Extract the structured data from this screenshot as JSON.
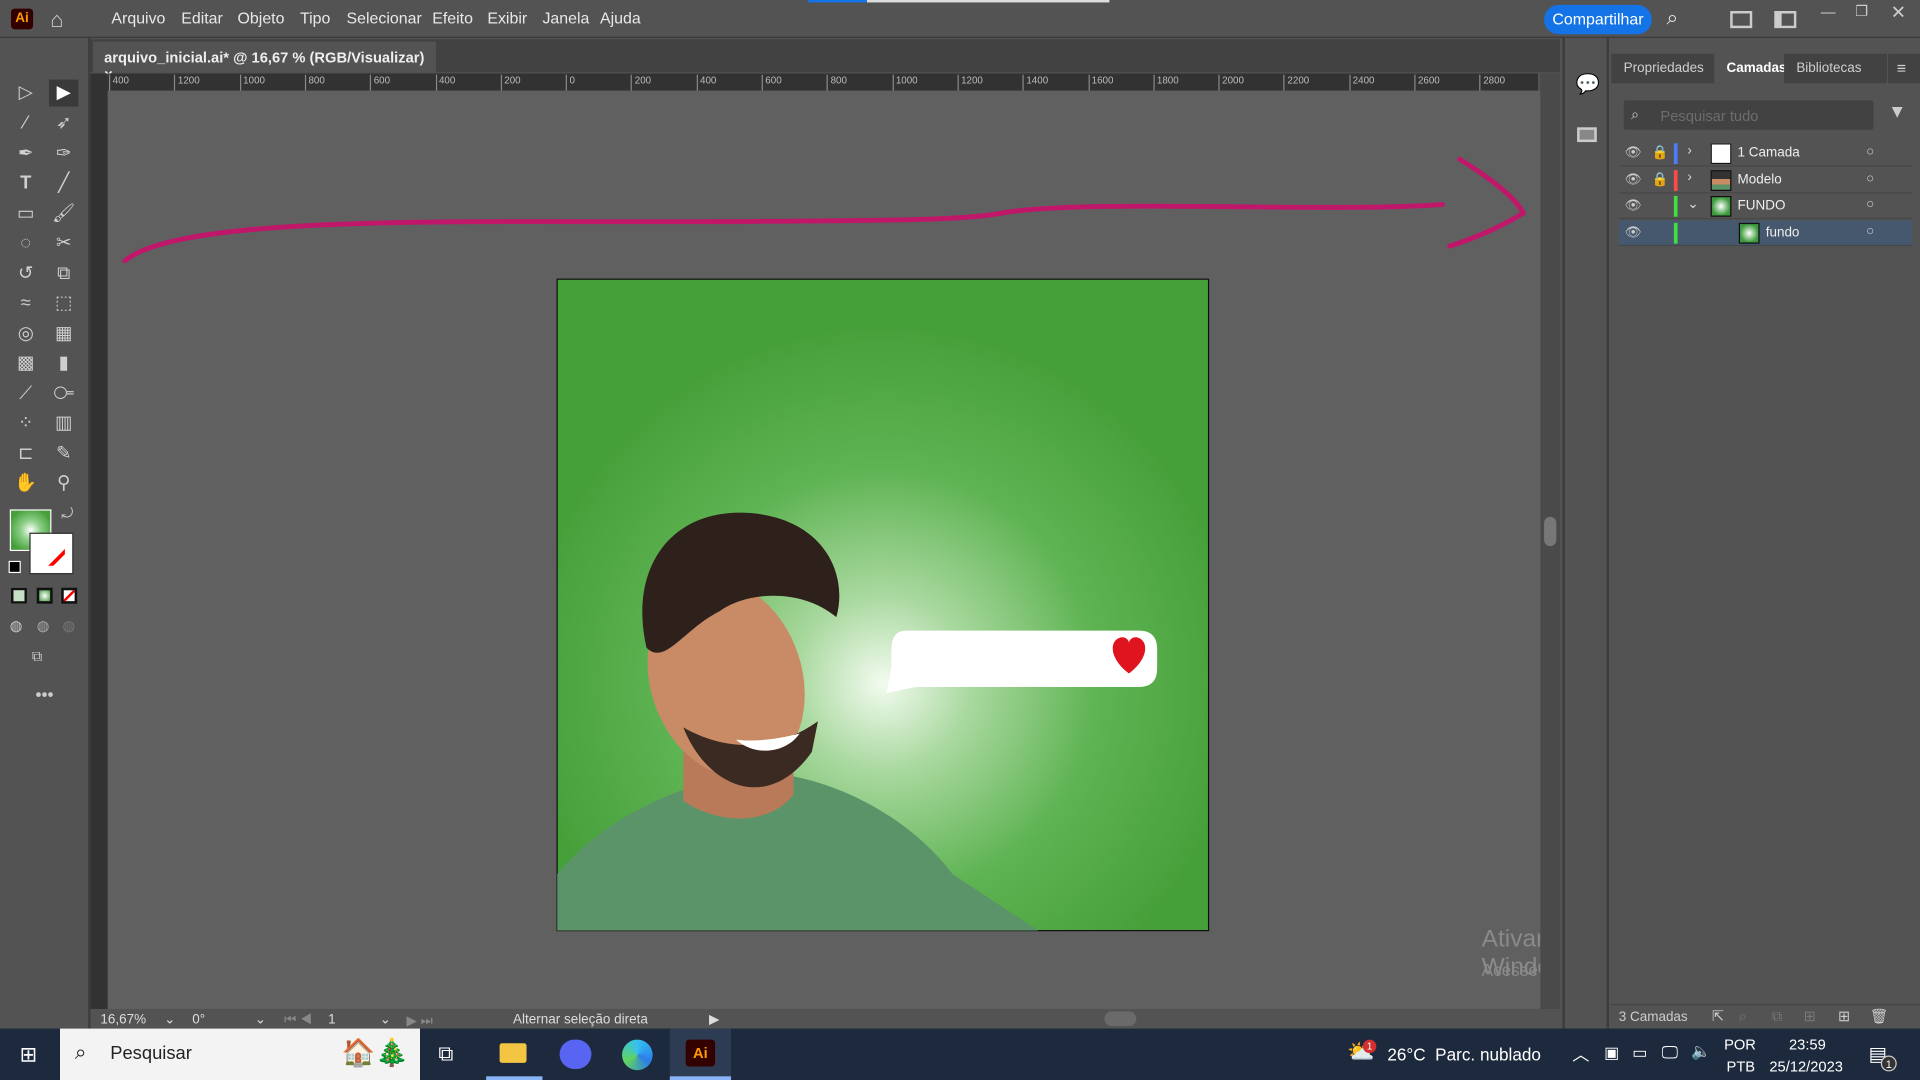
{
  "app": {
    "logo": "Ai",
    "menu": [
      "Arquivo",
      "Editar",
      "Objeto",
      "Tipo",
      "Selecionar",
      "Efeito",
      "Exibir",
      "Janela",
      "Ajuda"
    ],
    "share_label": "Compartilhar",
    "accent": "#1473e6"
  },
  "document": {
    "tab_title": "arquivo_inicial.ai* @ 16,67 % (RGB/Visualizar)",
    "close": "×"
  },
  "ruler": {
    "h_labels": [
      "400",
      "1200",
      "1000",
      "800",
      "600",
      "400",
      "200",
      "0",
      "200",
      "400",
      "600",
      "800",
      "1000",
      "1200",
      "1400",
      "1600",
      "1800",
      "2000",
      "2200",
      "2400",
      "2600",
      "2800"
    ]
  },
  "artboard": {
    "background": "#46a03a",
    "arrow_color": "#c0176a",
    "heart_color": "#e0141e"
  },
  "status": {
    "zoom": "16,67%",
    "rotation": "0°",
    "artboard": "1",
    "message": "Alternar seleção direta"
  },
  "panel": {
    "tabs": [
      "Propriedades",
      "Camadas",
      "Bibliotecas"
    ],
    "active_tab": "Camadas",
    "search_placeholder": "Pesquisar tudo",
    "layers": [
      {
        "name": "1 Camada",
        "color": "#4a7cff",
        "expanded": false,
        "locked": true
      },
      {
        "name": "Modelo",
        "color": "#ff4a4a",
        "expanded": false,
        "locked": true
      },
      {
        "name": "FUNDO",
        "color": "#3fe03f",
        "expanded": true,
        "locked": false
      },
      {
        "name": "fundo",
        "color": "#3fe03f",
        "sublayer": true,
        "selected": true
      }
    ],
    "footer": "3 Camadas"
  },
  "watermark": {
    "title": "Ativar o Windows",
    "subtitle": "Acesse Configurações para ativar o Windows."
  },
  "taskbar": {
    "search": "Pesquisar",
    "weather": "26°C  Parc. nublado",
    "weather_badge": "1",
    "lang1": "POR",
    "lang2": "PTB",
    "time": "23:59",
    "date": "25/12/2023",
    "notif": "1"
  }
}
